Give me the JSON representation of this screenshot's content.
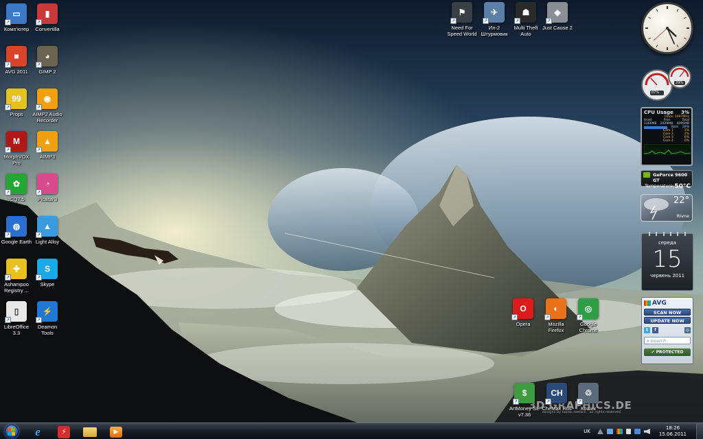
{
  "desktop": {
    "icons_left": [
      {
        "label": "Комп'ютер",
        "name": "computer",
        "color": "#3a78c8",
        "glyph": "▭"
      },
      {
        "label": "Convertilla",
        "name": "convertilla",
        "color": "#c83a3a",
        "glyph": "▮"
      },
      {
        "label": "AVG 2011",
        "name": "avg-2011",
        "color": "#d8452a",
        "glyph": "■"
      },
      {
        "label": "GIMP 2",
        "name": "gimp",
        "color": "#6b6250",
        "glyph": "◕"
      },
      {
        "label": "Props",
        "name": "props",
        "color": "#e6c21f",
        "glyph": "99"
      },
      {
        "label": "AIMP2 Audio\nRecorder",
        "name": "aimp2-audio-recorder",
        "color": "#f0a010",
        "glyph": "◉"
      },
      {
        "label": "MorphVOX\nPro",
        "name": "morphvox-pro",
        "color": "#b01818",
        "glyph": "M"
      },
      {
        "label": "AIMP3",
        "name": "aimp3",
        "color": "#f0a010",
        "glyph": "▲"
      },
      {
        "label": "ICQ7.5",
        "name": "icq",
        "color": "#22a832",
        "glyph": "✿"
      },
      {
        "label": "Picasa 3",
        "name": "picasa",
        "color": "#d94a8c",
        "glyph": "◔"
      },
      {
        "label": "Google Earth",
        "name": "google-earth",
        "color": "#2a6fd0",
        "glyph": "◍"
      },
      {
        "label": "Light Alloy",
        "name": "light-alloy",
        "color": "#3a9ae0",
        "glyph": "▲"
      },
      {
        "label": "Ashampoo\nRegistry ...",
        "name": "ashampoo-registry",
        "color": "#e8c020",
        "glyph": "✚"
      },
      {
        "label": "Skype",
        "name": "skype",
        "color": "#1aa8e6",
        "glyph": "S"
      },
      {
        "label": "LibreOffice\n3.3",
        "name": "libreoffice",
        "color": "#e8e8e8",
        "glyph": "▯"
      },
      {
        "label": "Deamon\nTools",
        "name": "daemon-tools",
        "color": "#1f78d8",
        "glyph": "⚡"
      }
    ],
    "icons_top": [
      {
        "label": "Need For\nSpeed World",
        "name": "need-for-speed-world",
        "color": "#3a3f45",
        "glyph": "⚑"
      },
      {
        "label": "Ил-2\nШтурмовик",
        "name": "il-2-shturmovik",
        "color": "#5c7fa8",
        "glyph": "✈"
      },
      {
        "label": "Multi Theft\nAuto",
        "name": "multi-theft-auto",
        "color": "#2a2a2a",
        "glyph": "☗"
      },
      {
        "label": "Just Cause 2",
        "name": "just-cause-2",
        "color": "#8a8f96",
        "glyph": "◈"
      }
    ],
    "icons_mid": [
      {
        "label": "Opera",
        "name": "opera",
        "color": "#d91c1c",
        "glyph": "O"
      },
      {
        "label": "Mozilla\nFirefox",
        "name": "mozilla-firefox",
        "color": "#e8731a",
        "glyph": "◐"
      },
      {
        "label": "Google\nChrome",
        "name": "google-chrome",
        "color": "#2e9e44",
        "glyph": "◎"
      }
    ],
    "icons_bottom": [
      {
        "label": "ArtMoney SE\nv7.36",
        "name": "artmoney",
        "color": "#3f9b3f",
        "glyph": "$"
      },
      {
        "label": "CheMax Rus",
        "name": "chemax-rus",
        "color": "#2a4a7a",
        "glyph": "CH"
      },
      {
        "label": "Кошик",
        "name": "recycle-bin",
        "color": "#5a6a7a",
        "glyph": "♲"
      }
    ],
    "watermark": "3D GRAPHICS.DE",
    "watermark_sub": "designs by tobias roetsch · all rights reserved"
  },
  "gadgets": {
    "cpu": {
      "title": "CPU Usage",
      "percent": "3%",
      "clock": "Clock: 1997MHz",
      "mem_headers": [
        "Used",
        "Free",
        "Total"
      ],
      "mem_values": [
        "1166MB",
        "2929MB",
        "4095MB"
      ],
      "ram_label": "Ram",
      "ram_percent": "28%",
      "cores": [
        {
          "label": "Core 1",
          "value": "3%"
        },
        {
          "label": "Core 2",
          "value": "2%"
        },
        {
          "label": "Core 3",
          "value": "6%"
        },
        {
          "label": "Core 4",
          "value": "0%"
        }
      ]
    },
    "meters": {
      "left": "07%",
      "right": "29%"
    },
    "gpu": {
      "name": "GeForce 9600 GT",
      "temp_label": "Temperature:",
      "temp_value": "50°C"
    },
    "weather": {
      "temp": "22°",
      "city": "Rivne"
    },
    "calendar": {
      "weekday": "середа",
      "day": "15",
      "month_year": "червень 2011"
    },
    "avg": {
      "brand": "AVG",
      "scan": "SCAN NOW",
      "update": "UPDATE NOW",
      "search_placeholder": "Search",
      "status": "PROTECTED",
      "socials": [
        "twitter",
        "facebook",
        "camera"
      ]
    },
    "clock_time": {
      "hour": 4,
      "minute": 26,
      "second": 38
    }
  },
  "taskbar": {
    "pinned": [
      "internet-explorer",
      "flash-app",
      "file-explorer",
      "media-player"
    ],
    "language": "UK",
    "time": "18:26",
    "date": "15.06.2011"
  },
  "colors": {
    "accent": "#1c4d8f",
    "taskbar": "#161b22"
  }
}
